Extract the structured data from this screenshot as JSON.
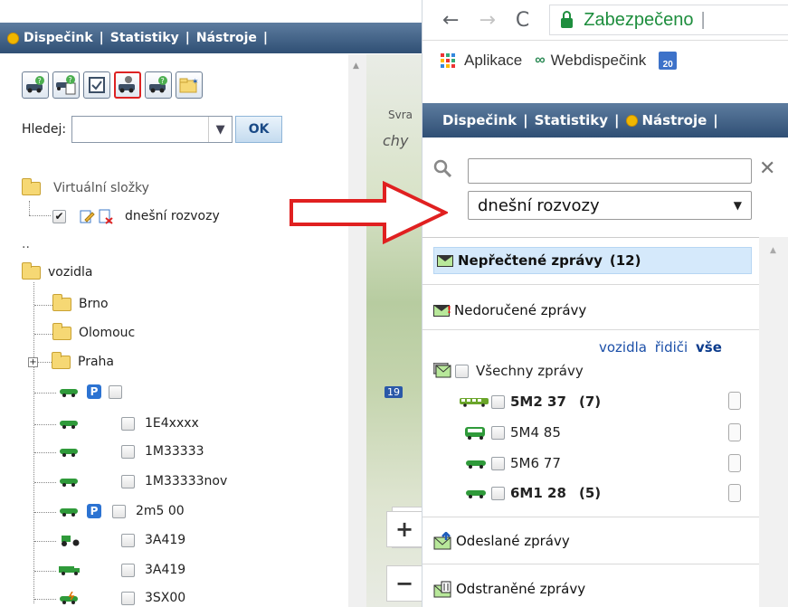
{
  "left": {
    "nav": {
      "dispatch": "Dispečink",
      "stats": "Statistiky",
      "tools": "Nástroje",
      "sep": "|"
    },
    "search": {
      "label": "Hledej:",
      "value": "",
      "ok": "OK"
    },
    "tree": {
      "virtual_folders": "Virtuální složky",
      "virtual_item": "dnešní rozvozy",
      "parent": "..",
      "root": "vozidla",
      "folders": [
        "Brno",
        "Olomouc",
        "Praha"
      ],
      "vehicles": [
        "1E4xxxx",
        "1M33333",
        "1M33333nov",
        "2m5 00",
        "3A419",
        "3A419",
        "3SX00"
      ]
    },
    "map": {
      "city": "chy",
      "sv": "Svra",
      "road": "19",
      "zoom_in": "+",
      "zoom_out": "−"
    }
  },
  "browser": {
    "address": {
      "secure": "Zabezpečeno",
      "sep": "|"
    },
    "bookmarks": {
      "apps": "Aplikace",
      "web": "Webdispečink",
      "cal": "20"
    },
    "nav": {
      "dispatch": "Dispečink",
      "stats": "Statistiky",
      "tools": "Nástroje",
      "sep": "|"
    },
    "search": {
      "value": "",
      "clear": "✕"
    },
    "select": {
      "value": "dnešní rozvozy"
    },
    "messages": {
      "unread": "Nepřečtené zprávy",
      "unread_count": "(12)",
      "undelivered": "Nedoručené zprávy",
      "filters": {
        "vehicles": "vozidla",
        "drivers": "řidiči",
        "all": "vše"
      },
      "all_messages": "Všechny zprávy",
      "vehicles": [
        {
          "name": "5M2 37",
          "count": "(7)"
        },
        {
          "name": "5M4 85",
          "count": ""
        },
        {
          "name": "5M6 77",
          "count": ""
        },
        {
          "name": "6M1 28",
          "count": "(5)"
        }
      ],
      "sent": "Odeslané zprávy",
      "deleted": "Odstraněné zprávy"
    }
  },
  "colors": {
    "accent": "#2f4f74",
    "dot": "#f1b700",
    "highlight": "#d5e9fb",
    "arrow": "#e02020"
  }
}
